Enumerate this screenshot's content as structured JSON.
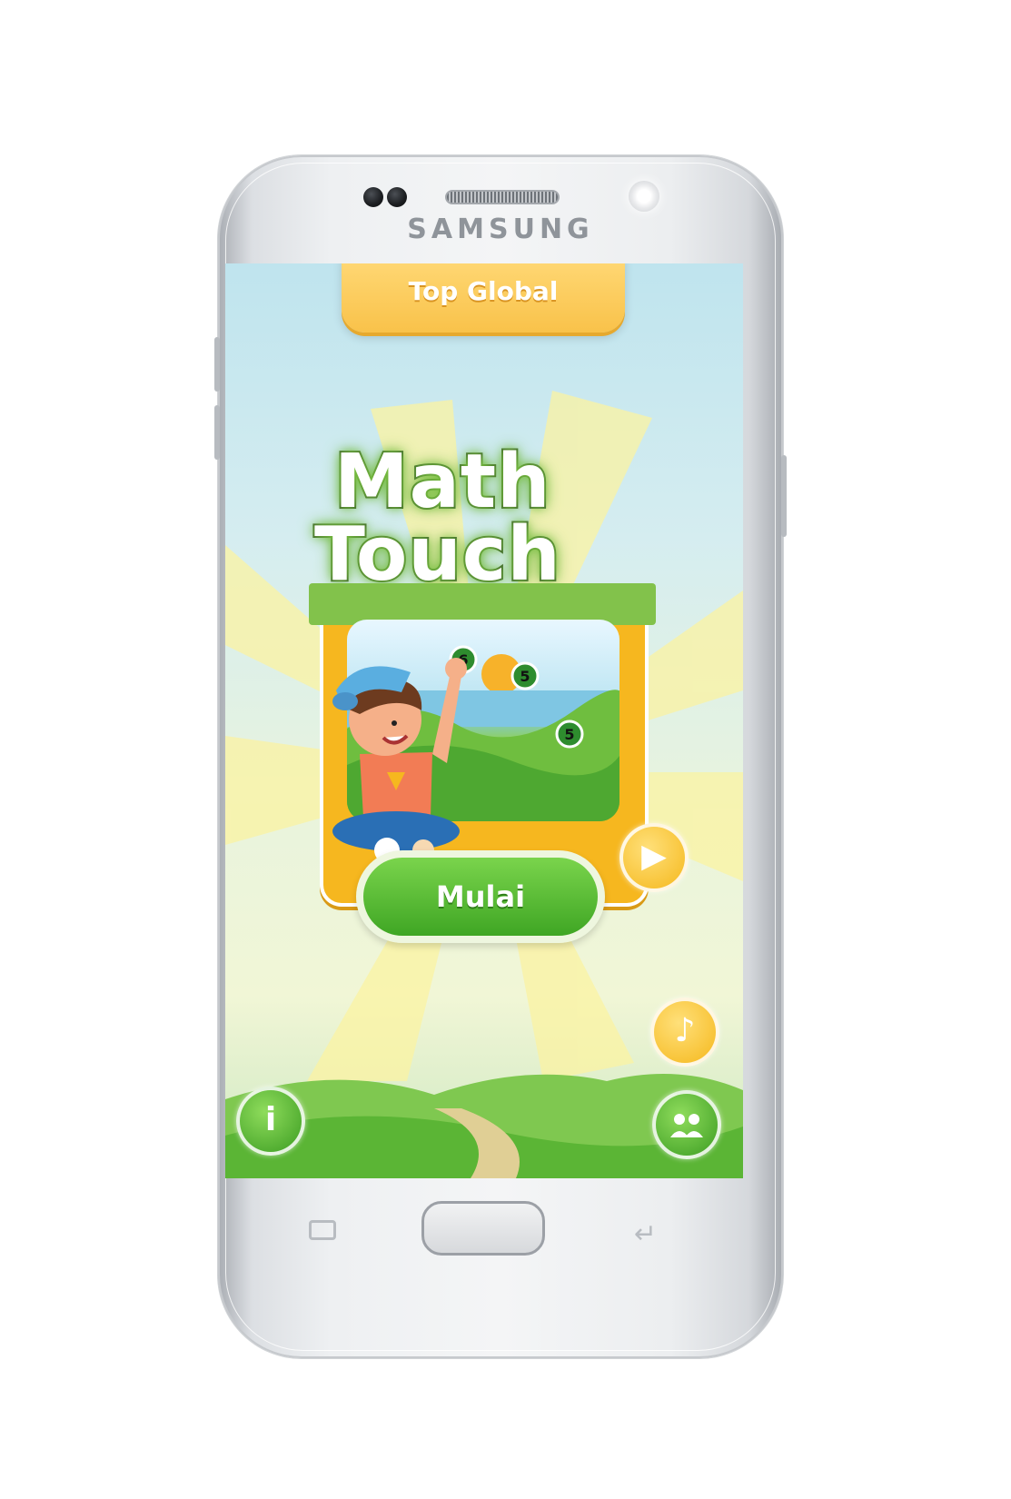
{
  "device": {
    "brand": "SAMSUNG"
  },
  "app": {
    "top_tab_label": "Top Global",
    "title_line1": "Math",
    "title_line2": "Touch",
    "start_button_label": "Mulai",
    "scene_numbers": [
      "6",
      "5",
      "5"
    ]
  },
  "icons": {
    "play": "play-icon",
    "music": "music-note-icon",
    "info": "info-icon",
    "friends": "friends-icon"
  },
  "colors": {
    "accent_yellow": "#f9c24a",
    "accent_green": "#3fa624",
    "sky": "#bfe4ee"
  }
}
